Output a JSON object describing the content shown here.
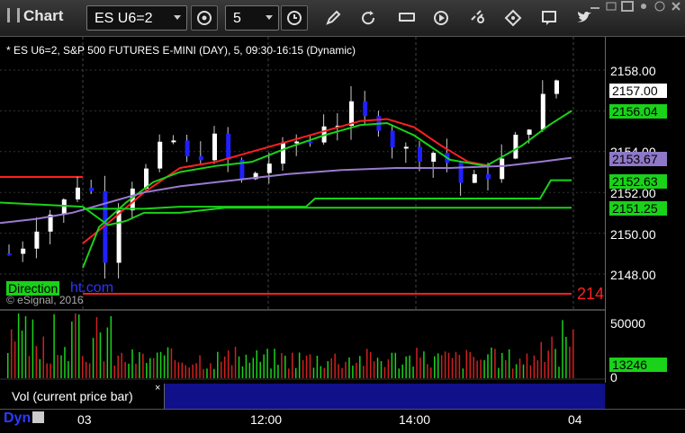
{
  "toolbar": {
    "app_title": "Chart",
    "symbol": "ES U6=2",
    "interval": "5",
    "icons": [
      "settings-gear-icon",
      "clock-icon",
      "pencil-icon",
      "refresh-icon",
      "get-icon",
      "play-icon",
      "link-icon",
      "comment-icon",
      "twitter-icon"
    ]
  },
  "chart": {
    "header": "* ES U6=2, S&P 500 FUTURES E-MINI (DAY), 5, 09:30-16:15 (Dynamic)",
    "brand_highlight": "Direction",
    "brand_rest": "ht.com",
    "copyright": "© eSignal, 2016",
    "red_last_label": "214",
    "price_ticks": [
      "2158.00",
      "2156.00",
      "2154.00",
      "2152.00",
      "2150.00",
      "2148.00"
    ],
    "price_tags": [
      {
        "label": "2157.00",
        "bg": "#ffffff",
        "fg": "#000000"
      },
      {
        "label": "2156.04",
        "bg": "#19d219",
        "fg": "#000000"
      },
      {
        "label": "2153.67",
        "bg": "#8f78c8",
        "fg": "#000000"
      },
      {
        "label": "2152.63",
        "bg": "#19d219",
        "fg": "#000000"
      },
      {
        "label": "2151.25",
        "bg": "#19d219",
        "fg": "#000000"
      }
    ]
  },
  "volume": {
    "label": "Vol (current price bar)",
    "close": "×",
    "ticks": [
      "50000",
      "0"
    ],
    "tag": {
      "label": "13246",
      "bg": "#19d219",
      "fg": "#000000"
    }
  },
  "time_axis": {
    "dyn_label": "Dyn",
    "ticks": [
      "03",
      "12:00",
      "14:00",
      "04"
    ]
  },
  "colors": {
    "up": "#ffffff",
    "down": "#2020ff",
    "ma_fast": "#ff2020",
    "ma_green": "#19d219",
    "vwap": "#9a7ad0",
    "bg": "#000000"
  }
}
